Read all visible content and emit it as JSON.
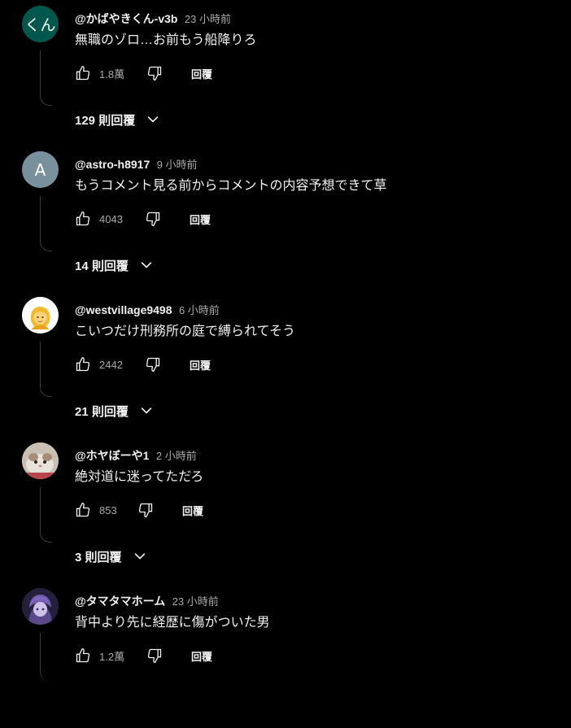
{
  "comments": [
    {
      "author": "@かばやきくん-v3b",
      "time": "23 小時前",
      "text": "無職のゾロ…お前もう船降りろ",
      "likes": "1.8萬",
      "reply_label": "回覆",
      "replies_label": "129 則回覆",
      "avatar": {
        "kind": "text",
        "text": "くん",
        "bg": "#00574b"
      }
    },
    {
      "author": "@astro-h8917",
      "time": "9 小時前",
      "text": "もうコメント見る前からコメントの内容予想できて草",
      "likes": "4043",
      "reply_label": "回覆",
      "replies_label": "14 則回覆",
      "avatar": {
        "kind": "letter",
        "text": "A",
        "bg": "#78909c"
      }
    },
    {
      "author": "@westvillage9498",
      "time": "6 小時前",
      "text": "こいつだけ刑務所の庭で縛られてそう",
      "likes": "2442",
      "reply_label": "回覆",
      "replies_label": "21 則回覆",
      "avatar": {
        "kind": "emoji",
        "text": "👱‍♀️",
        "bg": "#ffffff"
      }
    },
    {
      "author": "@ホヤぼーや1",
      "time": "2 小時前",
      "text": "絶対道に迷ってただろ",
      "likes": "853",
      "reply_label": "回覆",
      "replies_label": "3 則回覆",
      "avatar": {
        "kind": "photo",
        "text": "",
        "bg": "#b9b0a4"
      }
    },
    {
      "author": "@タマタマホーム",
      "time": "23 小時前",
      "text": "背中より先に経歴に傷がついた男",
      "likes": "1.2萬",
      "reply_label": "回覆",
      "replies_label": "",
      "avatar": {
        "kind": "photo2",
        "text": "",
        "bg": "#2a2540"
      }
    }
  ],
  "colors": {
    "background": "#000000",
    "primary_text": "#f1f1f1",
    "secondary_text": "#aaaaaa",
    "thread_line": "#3a3a3a"
  },
  "icons": {
    "like": "thumb-up-icon",
    "dislike": "thumb-down-icon",
    "expand": "chevron-down-icon"
  }
}
